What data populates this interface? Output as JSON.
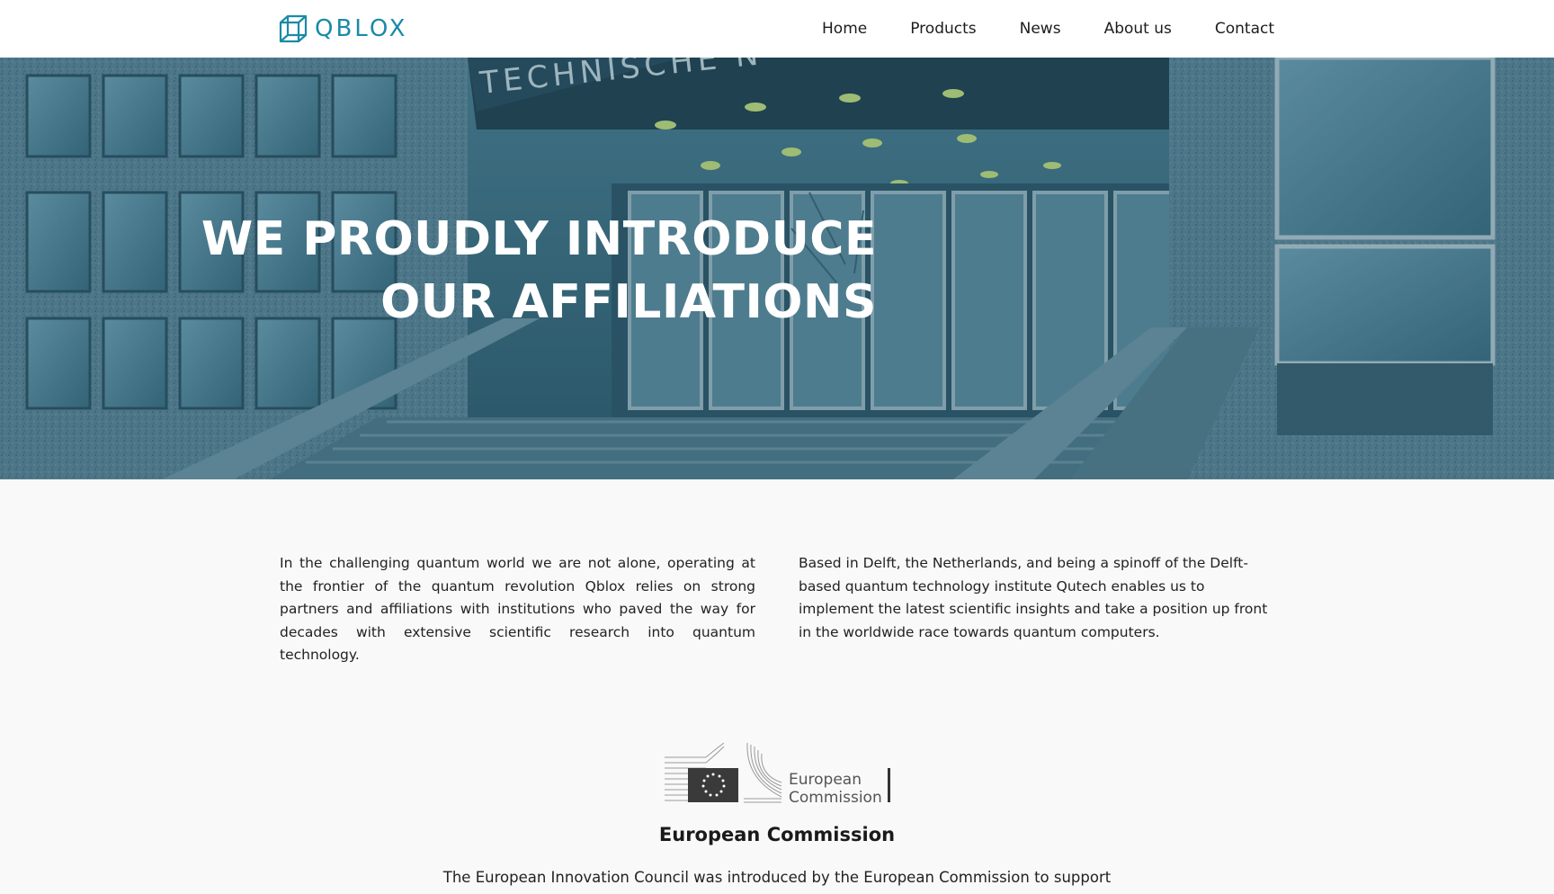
{
  "header": {
    "logo_text": "QBLOX",
    "nav": [
      {
        "label": "Home"
      },
      {
        "label": "Products"
      },
      {
        "label": "News"
      },
      {
        "label": "About us"
      },
      {
        "label": "Contact"
      }
    ]
  },
  "hero": {
    "title_line1": "WE PROUDLY INTRODUCE",
    "title_line2": "OUR AFFILIATIONS",
    "sign_text": "TECHNISCHE  N"
  },
  "intro": {
    "left": "In the challenging quantum world we are not alone, operating at the frontier of the quantum revolution Qblox relies on strong partners and affiliations with institutions who paved the way for decades with extensive scientific research into quantum technology.",
    "right": "Based in Delft, the Netherlands, and being a spinoff of the Delft-based quantum technology institute Qutech enables us to implement the latest scientific insights and take a position up front in the worldwide race towards quantum computers."
  },
  "affiliations": [
    {
      "logo_line1": "European",
      "logo_line2": "Commission",
      "name": "European Commission",
      "description": "The European Innovation Council was introduced by the European Commission to support"
    }
  ],
  "colors": {
    "brand": "#1a8aa8",
    "hero_overlay": "#2b5a6e",
    "page_bg": "#f9f9f9"
  },
  "icons": {
    "logo": "cube-icon",
    "ec_flag": "eu-flag-icon"
  }
}
